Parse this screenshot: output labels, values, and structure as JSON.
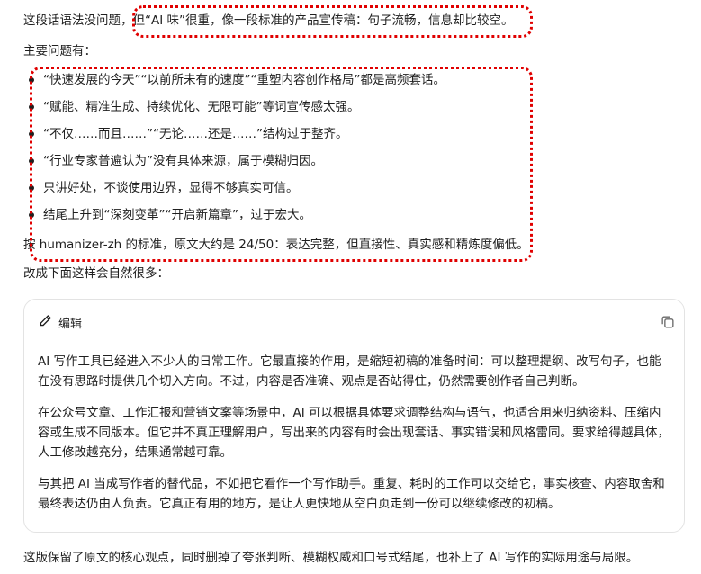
{
  "reply": {
    "intro": "这段话语法没问题，但“AI 味”很重，像一段标准的产品宣传稿：句子流畅，信息却比较空。",
    "issues_heading": "主要问题有：",
    "issues": [
      "“快速发展的今天”“以前所未有的速度”“重塑内容创作格局”都是高频套话。",
      "“赋能、精准生成、持续优化、无限可能”等词宣传感太强。",
      "“不仅……而且……”“无论……还是……”结构过于整齐。",
      "“行业专家普遍认为”没有具体来源，属于模糊归因。",
      "只讲好处，不谈使用边界，显得不够真实可信。",
      "结尾上升到“深刻变革”“开启新篇章”，过于宏大。"
    ],
    "score_line": "按 humanizer-zh 的标准，原文大约是 24/50：表达完整，但直接性、真实感和精炼度偏低。",
    "rewrite_lead": "改成下面这样会自然很多：",
    "closing": "这版保留了原文的核心观点，同时删掉了夸张判断、模糊权威和口号式结尾，也补上了 AI 写作的实际用途与局限。"
  },
  "card": {
    "edit_label": "编辑",
    "paragraphs": [
      "AI 写作工具已经进入不少人的日常工作。它最直接的作用，是缩短初稿的准备时间：可以整理提纲、改写句子，也能在没有思路时提供几个切入方向。不过，内容是否准确、观点是否站得住，仍然需要创作者自己判断。",
      "在公众号文章、工作汇报和营销文案等场景中，AI 可以根据具体要求调整结构与语气，也适合用来归纳资料、压缩内容或生成不同版本。但它并不真正理解用户，写出来的内容有时会出现套话、事实错误和风格雷同。要求给得越具体，人工修改越充分，结果通常越可靠。",
      "与其把 AI 当成写作者的替代品，不如把它看作一个写作助手。重复、耗时的工作可以交给它，事实核查、内容取舍和最终表达仍由人负责。它真正有用的地方，是让人更快地从空白页走到一份可以继续修改的初稿。"
    ]
  },
  "icons": {
    "edit": "pencil-icon",
    "copy": "copy-icon"
  },
  "colors": {
    "annotation": "#e00000",
    "text": "#1f1f1f",
    "card_border": "#e3e3e3"
  }
}
